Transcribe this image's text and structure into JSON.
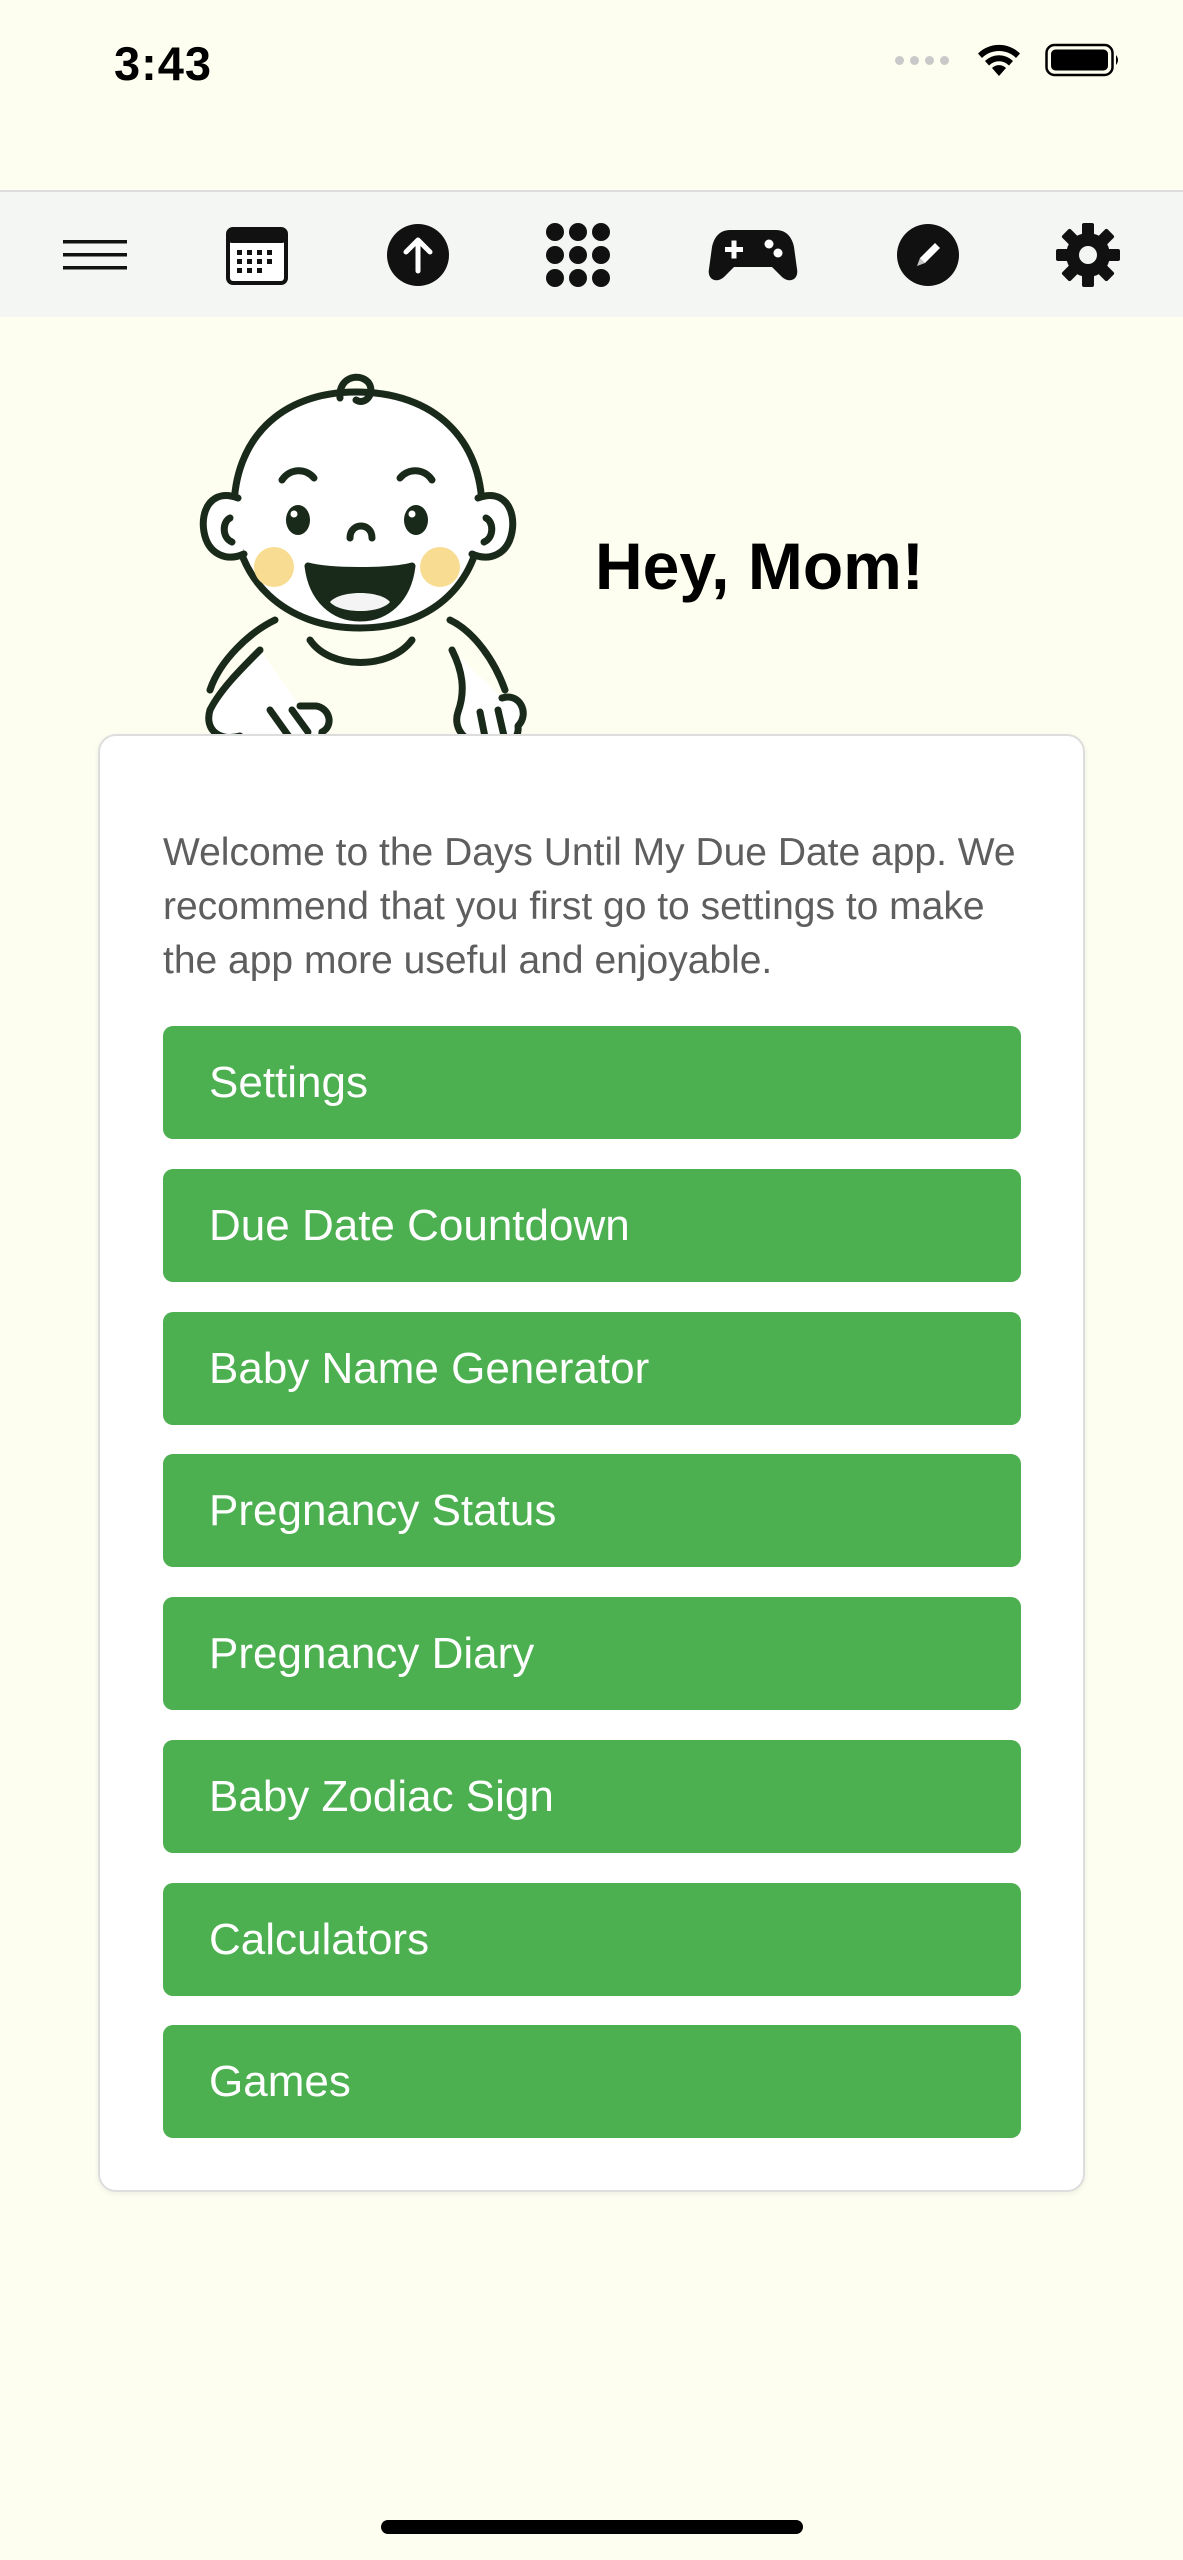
{
  "status_bar": {
    "time": "3:43"
  },
  "toolbar": {
    "icons": [
      "menu-icon",
      "calendar-icon",
      "upload-icon",
      "apps-grid-icon",
      "gamepad-icon",
      "edit-icon",
      "gear-icon"
    ]
  },
  "header": {
    "greeting": "Hey, Mom!"
  },
  "card": {
    "welcome_text": "Welcome to the Days Until My Due Date app. We recommend that you first go to settings to make the app more useful and enjoyable.",
    "buttons": [
      {
        "label": "Settings"
      },
      {
        "label": "Due Date Countdown"
      },
      {
        "label": "Baby Name Generator"
      },
      {
        "label": "Pregnancy Status"
      },
      {
        "label": "Pregnancy Diary"
      },
      {
        "label": "Baby Zodiac Sign"
      },
      {
        "label": "Calculators"
      },
      {
        "label": "Games"
      }
    ]
  },
  "colors": {
    "background": "#fdfdf0",
    "toolbar_bg": "#f4f6f3",
    "button_green": "#4caf50",
    "text_grey": "#5e5e5e"
  }
}
